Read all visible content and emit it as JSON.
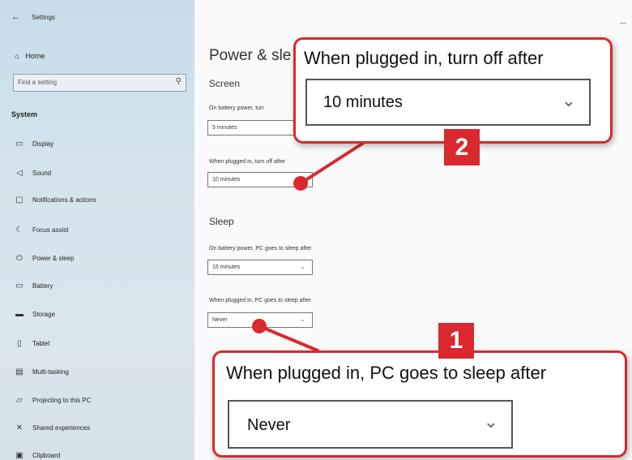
{
  "window": {
    "title": "Settings"
  },
  "sidebar": {
    "home_label": "Home",
    "search_placeholder": "Find a setting",
    "section_label": "System",
    "items": [
      {
        "label": "Display",
        "icon": "monitor-icon"
      },
      {
        "label": "Sound",
        "icon": "speaker-icon"
      },
      {
        "label": "Notifications & actions",
        "icon": "notifications-icon"
      },
      {
        "label": "Focus assist",
        "icon": "moon-icon"
      },
      {
        "label": "Power & sleep",
        "icon": "power-icon"
      },
      {
        "label": "Battery",
        "icon": "battery-icon"
      },
      {
        "label": "Storage",
        "icon": "storage-icon"
      },
      {
        "label": "Tablet",
        "icon": "tablet-icon"
      },
      {
        "label": "Multi-tasking",
        "icon": "multitasking-icon"
      },
      {
        "label": "Projecting to this PC",
        "icon": "projecting-icon"
      },
      {
        "label": "Shared experiences",
        "icon": "shared-icon"
      },
      {
        "label": "Clipboard",
        "icon": "clipboard-icon"
      }
    ]
  },
  "main": {
    "heading": "Power & sle",
    "screen": {
      "title": "Screen",
      "battery_label": "On battery power, turr",
      "battery_value": "5 minutes",
      "plugged_label": "When plugged in, turn off after",
      "plugged_value": "10 minutes"
    },
    "sleep": {
      "title": "Sleep",
      "battery_label": "On battery power, PC goes to sleep after",
      "battery_value": "15 minutes",
      "plugged_label": "When plugged in, PC goes to sleep after",
      "plugged_value": "Never"
    }
  },
  "callouts": {
    "one": {
      "number": "1",
      "title": "When plugged in, PC goes to sleep after",
      "value": "Never"
    },
    "two": {
      "number": "2",
      "title": "When plugged in, turn off after",
      "value": "10 minutes"
    }
  },
  "colors": {
    "accent_red": "#d9292f",
    "sidebar_bg": "#d0e0ea"
  }
}
